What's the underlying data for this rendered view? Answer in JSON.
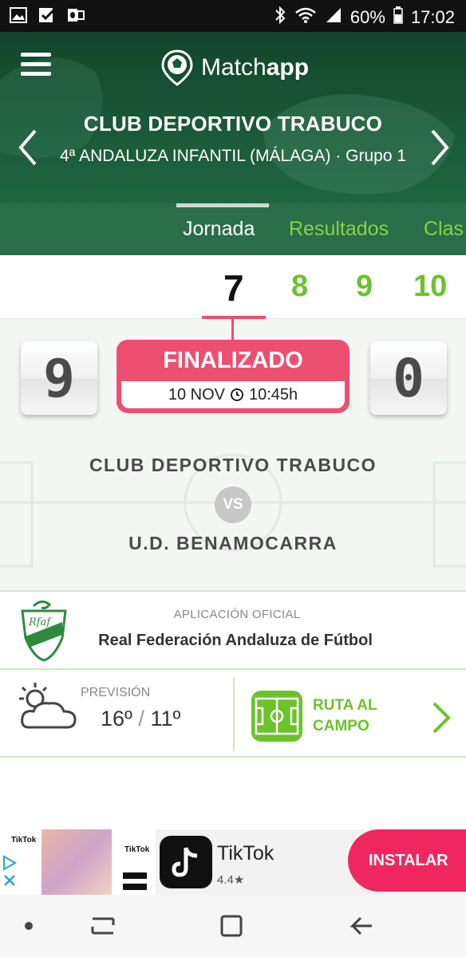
{
  "status_bar": {
    "battery": "60%",
    "time": "17:02",
    "left_icons": [
      "image-icon",
      "checkbox-icon",
      "outlook-icon"
    ],
    "right_icons": [
      "bluetooth-icon",
      "wifi-icon",
      "signal-icon"
    ]
  },
  "header": {
    "app_name_part1": "Match",
    "app_name_part2": "app",
    "club": "CLUB DEPORTIVO TRABUCO",
    "competition": "4ª ANDALUZA INFANTIL (MÁLAGA) · Grupo 1"
  },
  "tabs": [
    {
      "label": "Jornada",
      "active": true
    },
    {
      "label": "Resultados",
      "active": false
    },
    {
      "label": "Clas",
      "active": false
    }
  ],
  "jornadas": [
    "7",
    "8",
    "9",
    "10"
  ],
  "selected_jornada": "7",
  "match": {
    "home_score": "9",
    "away_score": "0",
    "status": "FINALIZADO",
    "date": "10 NOV",
    "time": "10:45h",
    "home_team": "CLUB DEPORTIVO TRABUCO",
    "vs": "VS",
    "away_team": "U.D. BENAMOCARRA"
  },
  "federation": {
    "caption": "APLICACIÓN OFICIAL",
    "name": "Real Federación Andaluza de Fútbol"
  },
  "weather": {
    "caption": "PREVISIÓN",
    "high": "16º",
    "separator": "/",
    "low": "11º"
  },
  "route": {
    "line1": "RUTA AL",
    "line2": "CAMPO"
  },
  "ad": {
    "app_name": "TikTok",
    "rating": "4.4★",
    "button": "INSTALAR",
    "thumb_label": "TikTok"
  },
  "colors": {
    "header_green": "#1b5a39",
    "tab_green": "#2a6e4a",
    "accent_green": "#6cc22c",
    "status_pink": "#ec4f6f",
    "install_pink": "#f0275e"
  }
}
